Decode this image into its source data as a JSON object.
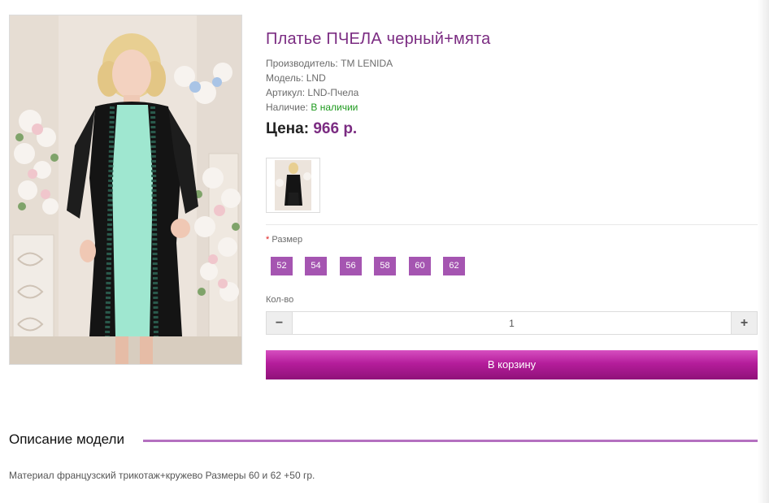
{
  "product": {
    "title": "Платье ПЧЕЛА черный+мята",
    "manufacturer_label": "Производитель:",
    "manufacturer": "TM LENIDA",
    "model_label": "Модель:",
    "model": "LND",
    "sku_label": "Артикул:",
    "sku": "LND-Пчела",
    "availability_label": "Наличие:",
    "availability": "В наличии",
    "price_label": "Цена:",
    "price": "966 р."
  },
  "options": {
    "size_required_mark": "*",
    "size_label": "Размер",
    "sizes": [
      "52",
      "54",
      "56",
      "58",
      "60",
      "62"
    ]
  },
  "quantity": {
    "label": "Кол-во",
    "value": "1",
    "minus": "−",
    "plus": "+"
  },
  "cart_button": "В корзину",
  "description": {
    "heading": "Описание модели",
    "text": "Материал французский трикотаж+кружево Размеры 60 и 62 +50 гр."
  },
  "colors": {
    "accent_purple": "#7b2c82",
    "size_button": "#a555b1",
    "cart_gradient_top": "#d64fc0",
    "cart_gradient_bottom": "#8f1179",
    "in_stock_green": "#1e9a1e",
    "dress_mint": "#9fe7d0",
    "dress_black": "#141414"
  }
}
